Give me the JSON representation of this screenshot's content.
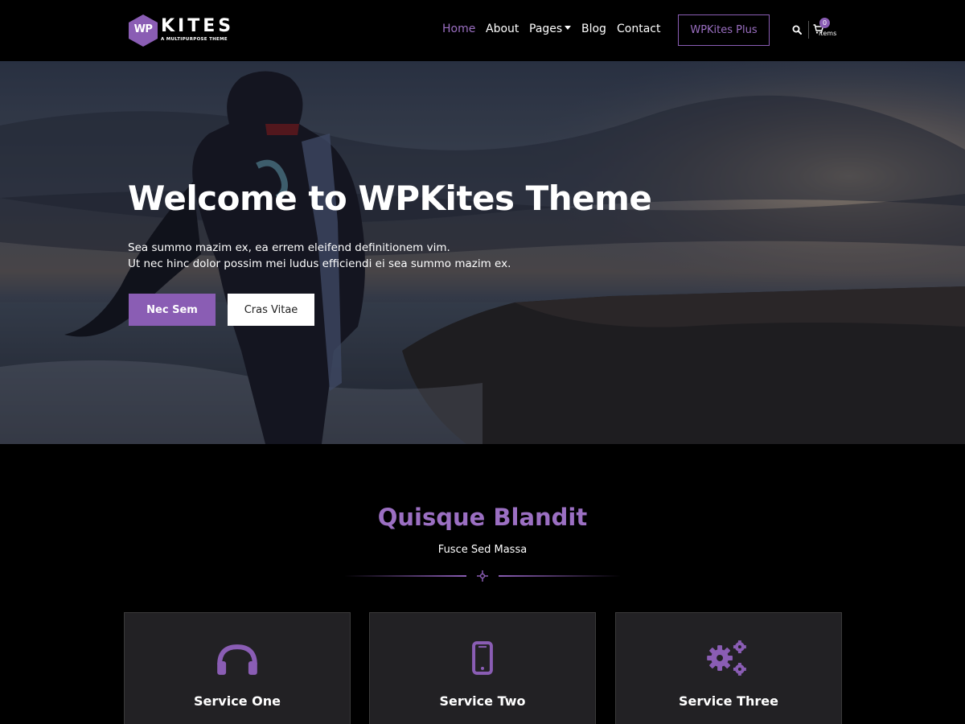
{
  "brand": {
    "logo_mark": "WP",
    "logo_word": "KITES",
    "tagline": "A MULTIPURPOSE THEME",
    "accent_color": "#8a5db4"
  },
  "nav": {
    "items": [
      {
        "label": "Home",
        "active": true
      },
      {
        "label": "About"
      },
      {
        "label": "Pages"
      },
      {
        "label": "Blog"
      },
      {
        "label": "Contact"
      }
    ],
    "cta_label": "WPKites Plus",
    "search_icon": "search-icon",
    "cart": {
      "count": "0",
      "label": "items"
    }
  },
  "hero": {
    "title": "Welcome to WPKites Theme",
    "line1": "Sea summo mazim ex, ea errem eleifend definitionem vim.",
    "line2": "Ut nec hinc dolor possim mei ludus efficiendi ei sea summo mazim ex.",
    "primary_button": "Nec Sem",
    "secondary_button": "Cras Vitae"
  },
  "services": {
    "title": "Quisque Blandit",
    "subtitle": "Fusce Sed Massa",
    "cards": [
      {
        "icon": "headphones-icon",
        "title": "Service One"
      },
      {
        "icon": "mobile-phone-icon",
        "title": "Service Two"
      },
      {
        "icon": "gears-icon",
        "title": "Service Three"
      }
    ]
  }
}
